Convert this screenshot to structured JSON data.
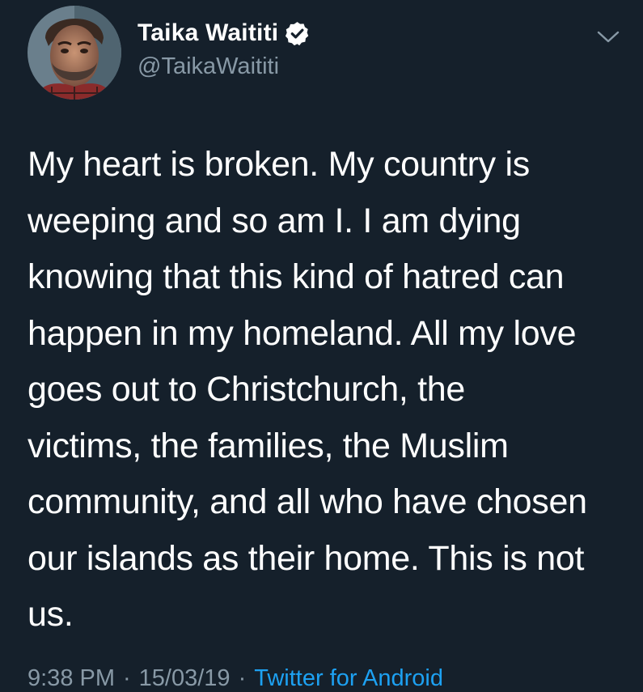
{
  "author": {
    "display_name": "Taika Waititi",
    "handle": "@TaikaWaititi",
    "verified_icon": "verified-badge-icon",
    "avatar_icon": "profile-photo"
  },
  "menu": {
    "icon": "chevron-down-icon"
  },
  "tweet": {
    "text": "My heart is broken. My country is\nweeping and so am I. I am dying\nknowing that this kind of hatred can\nhappen in my homeland. All my love\ngoes out to Christchurch, the\nvictims, the families, the Muslim\ncommunity, and all who have chosen\nour islands as their home. This is not\nus."
  },
  "meta": {
    "time": "9:38 PM",
    "date": "15/03/19",
    "source": "Twitter for Android"
  },
  "colors": {
    "background": "#15202b",
    "text": "#ffffff",
    "secondary": "#8899a6",
    "accent": "#1da1f2"
  }
}
